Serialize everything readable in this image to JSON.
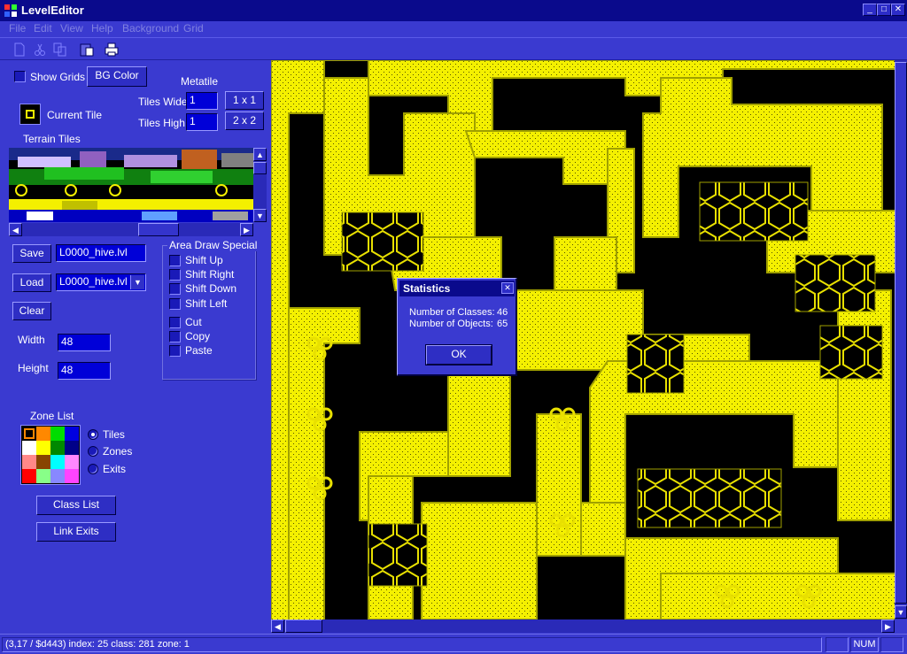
{
  "window": {
    "title": "LevelEditor",
    "min_glyph": "_",
    "max_glyph": "□",
    "close_glyph": "✕"
  },
  "menu": [
    "File",
    "Edit",
    "View",
    "Help",
    "Background",
    "Grid"
  ],
  "toolbar": [
    "new-icon",
    "cut-icon",
    "copy-icon",
    "paste-icon",
    "print-icon"
  ],
  "panel": {
    "show_grids_label": "Show Grids",
    "bg_color_label": "BG Color",
    "metatile_label": "Metatile",
    "current_tile_label": "Current Tile",
    "tiles_wide_label": "Tiles Wide",
    "tiles_wide_value": "1",
    "tiles_high_label": "Tiles High",
    "tiles_high_value": "1",
    "btn_1x1": "1 x 1",
    "btn_2x2": "2 x 2",
    "terrain_label": "Terrain Tiles",
    "save_label": "Save",
    "save_file": "L0000_hive.lvl",
    "load_label": "Load",
    "load_file": "L0000_hive.lvl",
    "clear_label": "Clear",
    "width_label": "Width",
    "width_value": "48",
    "height_label": "Height",
    "height_value": "48",
    "area_group_label": "Area Draw Special",
    "area_options": [
      "Shift Up",
      "Shift Right",
      "Shift Down",
      "Shift Left",
      "Cut",
      "Copy",
      "Paste"
    ],
    "zone_list_label": "Zone List",
    "zone_colors": [
      "#ff8800",
      "#ff8800",
      "#00dd00",
      "#0000e0",
      "#ffffff",
      "#ffff00",
      "#008800",
      "#000088",
      "#ff8888",
      "#884400",
      "#00ffff",
      "#ff88ff",
      "#ff0000",
      "#88ff88",
      "#8888ff",
      "#ff44ff"
    ],
    "radios": [
      "Tiles",
      "Zones",
      "Exits"
    ],
    "class_list_label": "Class List",
    "link_exits_label": "Link Exits"
  },
  "dialog": {
    "title": "Statistics",
    "classes_label": "Number of Classes:",
    "classes_value": "46",
    "objects_label": "Number of Objects:",
    "objects_value": "65",
    "ok_label": "OK"
  },
  "status": {
    "text": "(3,17 / $d443)  index: 25  class: 281  zone:  1",
    "num": "NUM"
  },
  "colors": {
    "yellow": "#f4f000",
    "dark_yellow": "#a0a000",
    "bg": "#3a3ad0"
  }
}
